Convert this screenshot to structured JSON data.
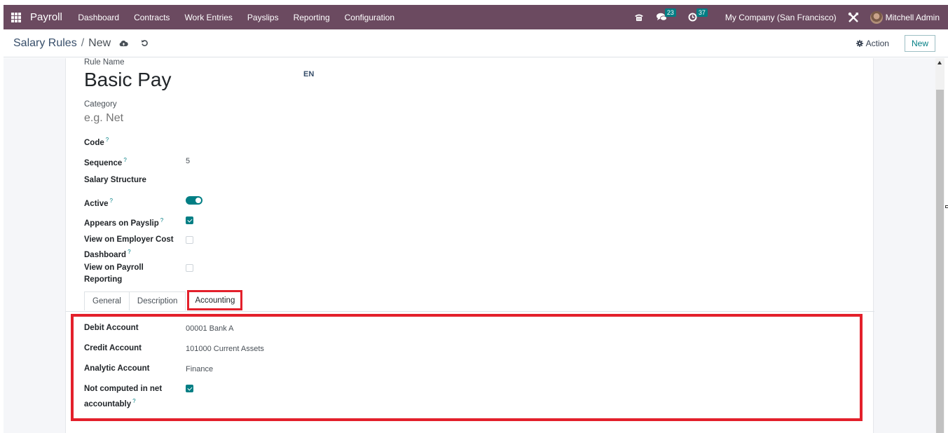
{
  "navbar": {
    "app_name": "Payroll",
    "menu": [
      "Dashboard",
      "Contracts",
      "Work Entries",
      "Payslips",
      "Reporting",
      "Configuration"
    ],
    "messages_count": "23",
    "activities_count": "37",
    "company": "My Company (San Francisco)",
    "user": "Mitchell Admin"
  },
  "control_panel": {
    "breadcrumb_parent": "Salary Rules",
    "breadcrumb_separator": "/",
    "breadcrumb_current": "New",
    "action_label": "Action",
    "new_label": "New"
  },
  "form": {
    "rule_name_label": "Rule Name",
    "rule_name": "Basic Pay",
    "language": "EN",
    "category_label": "Category",
    "category_placeholder": "e.g. Net",
    "code_label": "Code",
    "sequence_label": "Sequence",
    "sequence_value": "5",
    "salary_structure_label": "Salary Structure",
    "active_label": "Active",
    "active": true,
    "appears_on_payslip_label": "Appears on Payslip",
    "appears_on_payslip": true,
    "employer_cost_label_1": "View on Employer Cost",
    "employer_cost_label_2": "Dashboard",
    "employer_cost": false,
    "payroll_reporting_label_1": "View on Payroll",
    "payroll_reporting_label_2": "Reporting",
    "payroll_reporting": false,
    "help_mark": "?"
  },
  "tabs": [
    "General",
    "Description",
    "Accounting"
  ],
  "active_tab": "Accounting",
  "accounting": {
    "debit_label": "Debit Account",
    "debit_value": "00001 Bank A",
    "credit_label": "Credit Account",
    "credit_value": "101000 Current Assets",
    "analytic_label": "Analytic Account",
    "analytic_value": "Finance",
    "not_computed_label_1": "Not computed in net",
    "not_computed_label_2": "accountably",
    "not_computed": true
  },
  "colors": {
    "navbar": "#6b4a60",
    "accent": "#017e84",
    "highlight": "#e3202b"
  }
}
